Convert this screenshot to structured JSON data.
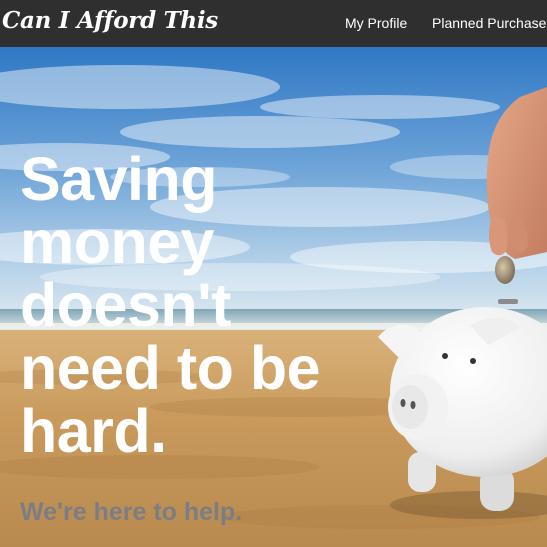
{
  "navbar": {
    "brand": "Can I Afford This",
    "links": [
      {
        "label": "My Profile"
      },
      {
        "label": "Planned Purchases"
      }
    ]
  },
  "hero": {
    "headline": "Saving money doesn't need to be hard.",
    "tagline": "We're here to help."
  },
  "colors": {
    "navbar_bg": "#2f2f2f",
    "headline": "#ffffff",
    "tagline": "#7b7d86",
    "sky": "#3f83c9",
    "sand": "#c9a36a"
  }
}
